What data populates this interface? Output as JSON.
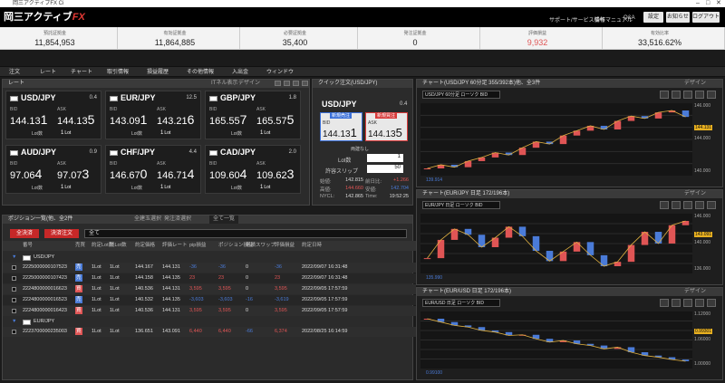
{
  "window": {
    "title": "岡三アクティブFX Ci"
  },
  "app": {
    "logo": "岡三アクティブ",
    "logo_fx": "FX"
  },
  "header": {
    "links": [
      "サポート/サービス情報",
      "操作マニュアル",
      "Q&A"
    ],
    "buttons": [
      "設定",
      "お知らせ",
      "ログアウト"
    ]
  },
  "summary": [
    {
      "label": "預託証拠金",
      "value": "11,854,953"
    },
    {
      "label": "有効証拠金",
      "value": "11,864,885"
    },
    {
      "label": "必要証拠金",
      "value": "35,400"
    },
    {
      "label": "発注証拠金",
      "value": "0"
    },
    {
      "label": "評価損益",
      "value": "9,932"
    },
    {
      "label": "有効比率",
      "value": "33,516.62%"
    }
  ],
  "colors": {
    "accent": "#e53935",
    "negative": "#4a7bd8",
    "positive": "#e05555"
  },
  "menu": [
    "注文",
    "レート",
    "チャート",
    "取引情報",
    "損益履歴",
    "その他情報",
    "入出金",
    "ウィンドウ"
  ],
  "rate_panel": {
    "title": "レート",
    "options": "ITネル表示",
    "design": "デザイン",
    "cards": [
      {
        "pair": "USD/JPY",
        "spread": "0.4",
        "bid_label": "BID",
        "ask_label": "ASK",
        "bid_main": "144.13",
        "bid_big": "1",
        "ask_main": "144.13",
        "ask_big": "5",
        "lot_label": "Lot数",
        "lot": "1",
        "lot_unit": "Lot"
      },
      {
        "pair": "EUR/JPY",
        "spread": "12.5",
        "bid_label": "BID",
        "ask_label": "ASK",
        "bid_main": "143.09",
        "bid_big": "1",
        "ask_main": "143.21",
        "ask_big": "6",
        "lot_label": "Lot数",
        "lot": "1",
        "lot_unit": "Lot"
      },
      {
        "pair": "GBP/JPY",
        "spread": "1.8",
        "bid_label": "BID",
        "ask_label": "ASK",
        "bid_main": "165.55",
        "bid_big": "7",
        "ask_main": "165.57",
        "ask_big": "5",
        "lot_label": "Lot数",
        "lot": "1",
        "lot_unit": "Lot"
      },
      {
        "pair": "AUD/JPY",
        "spread": "0.9",
        "bid_label": "BID",
        "ask_label": "ASK",
        "bid_main": "97.06",
        "bid_big": "4",
        "ask_main": "97.07",
        "ask_big": "3",
        "lot_label": "Lot数",
        "lot": "1",
        "lot_unit": "Lot"
      },
      {
        "pair": "CHF/JPY",
        "spread": "4.4",
        "bid_label": "BID",
        "ask_label": "ASK",
        "bid_main": "146.67",
        "bid_big": "0",
        "ask_main": "146.71",
        "ask_big": "4",
        "lot_label": "Lot数",
        "lot": "1",
        "lot_unit": "Lot"
      },
      {
        "pair": "CAD/JPY",
        "spread": "2.0",
        "bid_label": "BID",
        "ask_label": "ASK",
        "bid_main": "109.60",
        "bid_big": "4",
        "ask_main": "109.62",
        "ask_big": "3",
        "lot_label": "Lot数",
        "lot": "1",
        "lot_unit": "Lot"
      }
    ]
  },
  "quick_order": {
    "title": "クイック注文(USD/JPY)",
    "pair": "USD/JPY",
    "spread": "0.4",
    "sell_label": "新規売注",
    "buy_label": "新規買注",
    "bid_label": "BID",
    "ask_label": "ASK",
    "bid_main": "144.13",
    "bid_big": "1",
    "ask_main": "144.13",
    "ask_big": "5",
    "settle": "両建なし",
    "lot_label": "Lot数",
    "lot": "1",
    "slip_label": "許容スリップ",
    "slip": "50",
    "stats": [
      {
        "l": "始値:",
        "v": "142.815"
      },
      {
        "l": "前日比:",
        "v": "+1.266"
      },
      {
        "l": "高値:",
        "v": "144.660"
      },
      {
        "l": "安値:",
        "v": "142.704"
      },
      {
        "l": "NYCL:",
        "v": "142.865"
      },
      {
        "l": "Time:",
        "v": "19:52:25"
      }
    ]
  },
  "positions": {
    "title": "ポジション一覧(他、全2件",
    "filter1": "全建玉選択",
    "filter2": "発注済選択",
    "filter3": "全て一覧",
    "btn_all": "全決済",
    "btn_settle": "決済注文",
    "select": "全て",
    "columns": [
      "番号",
      "売買",
      "約定Lot数",
      "残Lot数",
      "約定価格",
      "評価レート",
      "pip損益",
      "ポジション損益",
      "累積スワップ",
      "評価損益",
      "約定日時"
    ],
    "groups": [
      {
        "pair": "USD/JPY",
        "rows": [
          [
            "2225000000107523",
            "売",
            "1Lot",
            "1Lot",
            "144.167",
            "144.131",
            "-36",
            "-36",
            "0",
            "-36",
            "2022/09/07 16:31:48"
          ],
          [
            "2225000000107423",
            "売",
            "1Lot",
            "1Lot",
            "144.158",
            "144.135",
            "23",
            "23",
            "0",
            "23",
            "2022/09/07 16:31:48"
          ],
          [
            "2224800000016623",
            "買",
            "1Lot",
            "1Lot",
            "140.536",
            "144.131",
            "3,595",
            "3,595",
            "0",
            "3,595",
            "2022/09/05 17:57:59"
          ],
          [
            "2224800000016523",
            "売",
            "1Lot",
            "1Lot",
            "140.532",
            "144.135",
            "-3,603",
            "-3,603",
            "-16",
            "-3,619",
            "2022/09/05 17:57:59"
          ],
          [
            "2224800000016423",
            "買",
            "1Lot",
            "1Lot",
            "140.536",
            "144.131",
            "3,595",
            "3,595",
            "0",
            "3,595",
            "2022/09/05 17:57:59"
          ]
        ]
      },
      {
        "pair": "EUR/JPY",
        "rows": [
          [
            "2223700000235003",
            "買",
            "1Lot",
            "1Lot",
            "136.651",
            "143.091",
            "6,440",
            "6,440",
            "-66",
            "6,374",
            "2022/08/25 16:14:59"
          ]
        ]
      }
    ]
  },
  "charts": [
    {
      "title": "チャート(USD/JPY 60分足 355/392本)他、全3件",
      "pair": "USD/JPY 60分足 ローソク BID",
      "design": "デザイン",
      "last": "144.131",
      "low": "139.914",
      "values": [
        139.9,
        140.2,
        140.0,
        140.5,
        140.8,
        141.2,
        141.0,
        141.6,
        142.1,
        141.9,
        142.6,
        143.0,
        143.4,
        143.1,
        143.8,
        144.2,
        144.0,
        144.5,
        144.66,
        144.13
      ],
      "ymax": "146.000",
      "ymid": "144.000",
      "ymin": "140.000"
    },
    {
      "title": "チャート(EUR/JPY 日足 172/196本)",
      "pair": "EUR/JPY 日足 ローソク BID",
      "design": "デザイン",
      "last": "143.091",
      "low": "135.990",
      "values": [
        138.0,
        140.5,
        142.0,
        141.2,
        139.5,
        140.8,
        142.3,
        141.0,
        139.0,
        137.6,
        138.9,
        140.2,
        138.4,
        136.9,
        137.5,
        139.8,
        141.6,
        140.0,
        142.5,
        143.09
      ],
      "ymax": "146.000",
      "ymid": "140.000",
      "ymin": "136.000"
    },
    {
      "title": "チャート(EUR/USD 日足 172/196本)",
      "pair": "EUR/USD 日足 ローソク BID",
      "design": "デザイン",
      "last": "0.99301",
      "low": "0.99100",
      "values": [
        1.12,
        1.11,
        1.1,
        1.095,
        1.085,
        1.08,
        1.07,
        1.072,
        1.06,
        1.05,
        1.055,
        1.045,
        1.04,
        1.03,
        1.035,
        1.02,
        1.01,
        1.005,
        0.998,
        0.993
      ],
      "ymax": "1.12000",
      "ymid": "1.06000",
      "ymin": "1.00000"
    }
  ]
}
